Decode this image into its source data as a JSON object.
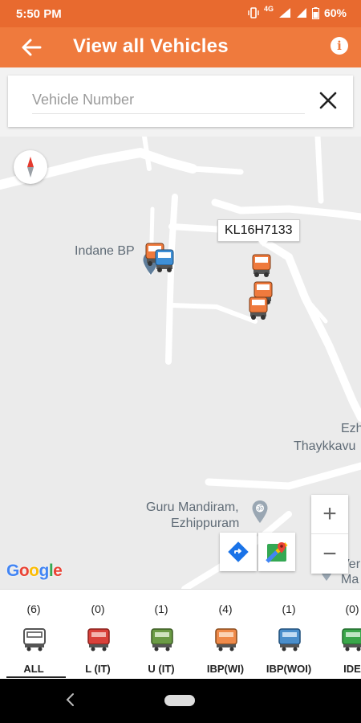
{
  "status_bar": {
    "time": "5:50 PM",
    "network": "4G",
    "battery": "60%"
  },
  "app_bar": {
    "title": "View all Vehicles",
    "back_icon": "arrow-left-icon",
    "info_icon": "info-icon"
  },
  "search": {
    "placeholder": "Vehicle Number",
    "value": "",
    "clear_icon": "close-icon"
  },
  "map": {
    "places": [
      {
        "name": "Indane BP"
      },
      {
        "name": "Ezh"
      },
      {
        "name": "Thaykkavu"
      },
      {
        "name": "Guru Mandiram,"
      },
      {
        "name": "Ezhippuram"
      },
      {
        "name": "Ver"
      },
      {
        "name": "Ma"
      }
    ],
    "callout": "KL16H7133",
    "attribution": "Google",
    "zoom_in": "+",
    "zoom_out": "−",
    "colors": {
      "land": "#ebebeb",
      "road": "#ffffff",
      "truck_orange": "#ef7a3d",
      "truck_blue": "#3e8fd6"
    }
  },
  "filters": [
    {
      "count": "(6)",
      "label": "ALL",
      "color": "#555555",
      "selected": true
    },
    {
      "count": "(0)",
      "label": "L (IT)",
      "color": "#d9403a",
      "selected": false
    },
    {
      "count": "(1)",
      "label": "U (IT)",
      "color": "#6a9a45",
      "selected": false
    },
    {
      "count": "(4)",
      "label": "IBP(WI)",
      "color": "#ef8a4a",
      "selected": false
    },
    {
      "count": "(1)",
      "label": "IBP(WOI)",
      "color": "#4a8ecb",
      "selected": false
    },
    {
      "count": "(0)",
      "label": "IDE",
      "color": "#3aa64a",
      "selected": false
    }
  ],
  "nav_bar": {
    "back_icon": "nav-back-icon",
    "home_icon": "nav-home-icon"
  }
}
